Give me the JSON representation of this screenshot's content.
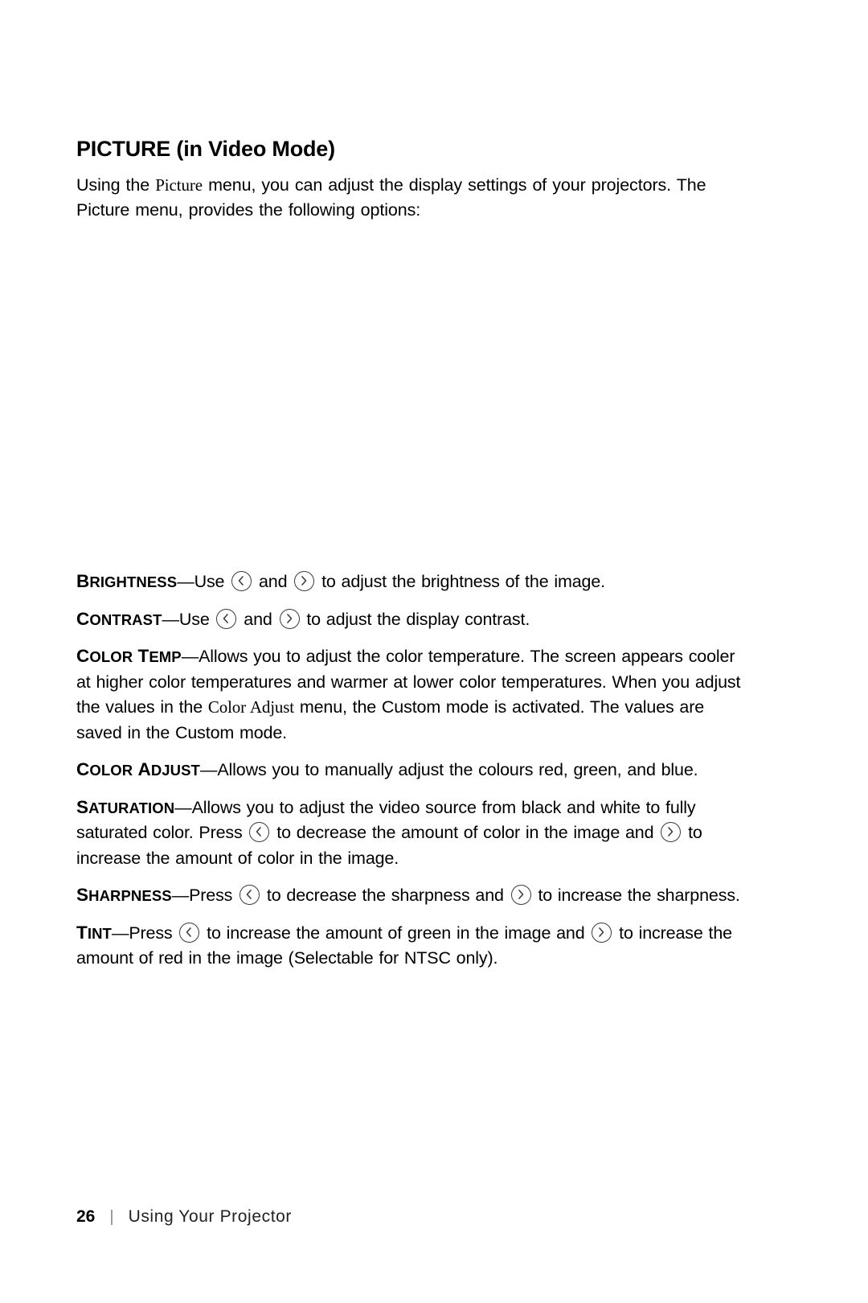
{
  "document": {
    "title": "PICTURE (in Video Mode)",
    "intro_1": "Using the ",
    "intro_menu": "Picture",
    "intro_2": " menu, you can adjust the display settings of your projectors. The Picture menu, provides the following options:",
    "options": [
      {
        "term": "BRIGHTNESS",
        "term_first": "B",
        "term_rest": "RIGHTNESS",
        "dash": "—",
        "text_1": "Use ",
        "key_left": "left-arrow-key",
        "text_2": " and ",
        "key_right": "right-arrow-key",
        "text_3": " to adjust the brightness of the image."
      },
      {
        "term": "CONTRAST",
        "term_first": "C",
        "term_rest": "ONTRAST",
        "dash": "—",
        "text_1": "Use ",
        "key_left": "left-arrow-key",
        "text_2": " and ",
        "key_right": "right-arrow-key",
        "text_3": " to adjust the display contrast."
      },
      {
        "term": "COLOR TEMP",
        "term_first": "C",
        "term_rest": "OLOR ",
        "term_first_2": "T",
        "term_rest_2": "EMP",
        "dash": "—",
        "text_1": "Allows you to adjust the color temperature. The screen appears cooler at higher color temperatures and warmer at lower color temperatures. When you adjust the values in the ",
        "inline_menu": "Color Adjust",
        "text_2": " menu, the Custom mode is activated. The values are saved in the Custom mode."
      },
      {
        "term": "COLOR ADJUST",
        "term_first": "C",
        "term_rest": "OLOR ",
        "term_first_2": "A",
        "term_rest_2": "DJUST",
        "dash": "—",
        "text_1": "Allows you to manually adjust the colours red, green, and blue."
      },
      {
        "term": "SATURATION",
        "term_first": "S",
        "term_rest": "ATURATION",
        "dash": "—",
        "text_1": "Allows you to adjust the video source from black and white to fully saturated color. Press ",
        "key_left": "left-arrow-key",
        "text_2": " to decrease the amount of color in the image and ",
        "key_right": "right-arrow-key",
        "text_3": " to increase the amount of color in the image."
      },
      {
        "term": "SHARPNESS",
        "term_first": "S",
        "term_rest": "HARPNESS",
        "dash": "—",
        "text_1": "Press ",
        "key_left": "left-arrow-key",
        "text_2": " to decrease the sharpness and ",
        "key_right": "right-arrow-key",
        "text_3": " to increase the sharpness."
      },
      {
        "term": "TINT",
        "term_first": "T",
        "term_rest": "INT",
        "dash": "—",
        "text_1": "Press ",
        "key_left": "left-arrow-key",
        "text_2": " to increase the amount of green in the image and ",
        "key_right": "right-arrow-key",
        "text_3": " to increase the amount of red in the image (Selectable for NTSC only)."
      }
    ]
  },
  "footer": {
    "page_number": "26",
    "separator": "|",
    "section": "Using Your Projector"
  },
  "colors": {
    "text": "#000000",
    "key_outline": "#3a3a3a",
    "footer_rule": "#888888"
  }
}
